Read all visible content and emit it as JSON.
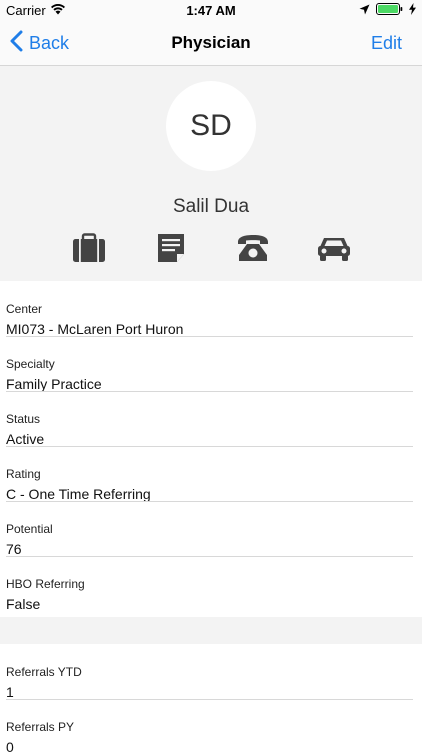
{
  "status_bar": {
    "carrier": "Carrier",
    "time": "1:47 AM",
    "icons": [
      "wifi-icon",
      "location-arrow-icon",
      "battery-icon",
      "charging-bolt-icon"
    ]
  },
  "nav": {
    "back_label": "Back",
    "title": "Physician",
    "edit_label": "Edit",
    "accent_color": "#1f7ee8"
  },
  "profile": {
    "initials": "SD",
    "name": "Salil Dua",
    "actions": [
      "briefcase-icon",
      "note-icon",
      "phone-icon",
      "car-icon"
    ]
  },
  "details": [
    {
      "label": "Center",
      "value": "MI073 - McLaren Port Huron"
    },
    {
      "label": "Specialty",
      "value": "Family Practice"
    },
    {
      "label": "Status",
      "value": "Active"
    },
    {
      "label": "Rating",
      "value": "C - One Time Referring"
    },
    {
      "label": "Potential",
      "value": "76"
    },
    {
      "label": "HBO Referring",
      "value": "False"
    }
  ],
  "referrals": [
    {
      "label": "Referrals YTD",
      "value": "1"
    },
    {
      "label": "Referrals PY",
      "value": "0"
    }
  ]
}
